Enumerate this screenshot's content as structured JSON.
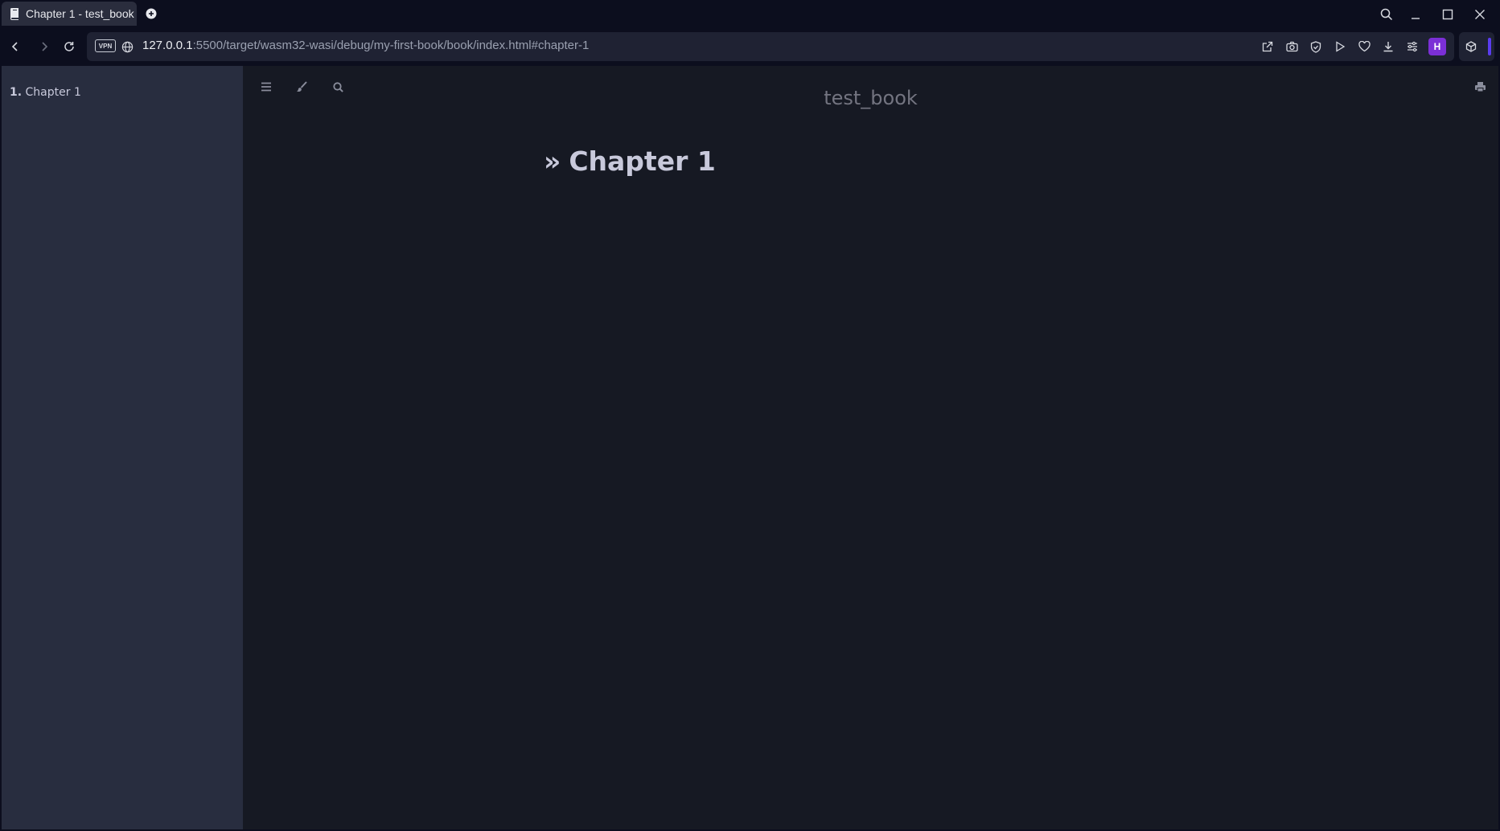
{
  "browser": {
    "tab": {
      "title": "Chapter 1 - test_book",
      "icon": "book-icon"
    },
    "new_tab_icon": "plus-icon",
    "window_controls": [
      "search-icon",
      "minimize-icon",
      "maximize-icon",
      "close-icon"
    ],
    "url": {
      "host": "127.0.0.1",
      "rest": ":5500/target/wasm32-wasi/debug/my-first-book/book/index.html#chapter-1"
    },
    "vpn_label": "VPN",
    "profile_initial": "H",
    "accent": "#7b2fd6"
  },
  "book": {
    "title": "test_book",
    "sidebar": {
      "items": [
        {
          "number": "1.",
          "label": "Chapter 1"
        }
      ]
    },
    "heading_prefix": "»",
    "heading": "Chapter 1"
  },
  "colors": {
    "sidebar_bg": "#282d3f",
    "content_bg": "#161923",
    "browser_bg": "#0c0e1e"
  }
}
